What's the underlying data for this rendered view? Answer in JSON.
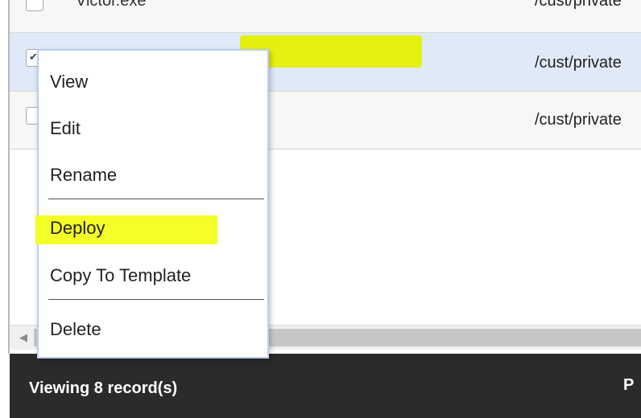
{
  "grid": {
    "rows": [
      {
        "name": "Victor.exe",
        "path": "/cust/private",
        "checked": false,
        "selected": false
      },
      {
        "name": "",
        "path": "/cust/private",
        "checked": true,
        "selected": true
      },
      {
        "name": "",
        "path": "/cust/private",
        "checked": false,
        "selected": false
      }
    ],
    "checkmark_glyph": "✔"
  },
  "context_menu": {
    "items": [
      "View",
      "Edit",
      "Rename",
      "Deploy",
      "Copy To Template",
      "Delete"
    ],
    "highlighted_item": "Deploy"
  },
  "footer": {
    "record_count_text": "Viewing 8 record(s)",
    "right_text": "P"
  },
  "scrollbar": {
    "left_arrow": "◀"
  },
  "colors": {
    "highlight": "#f3ff26",
    "selected_row": "#dfe9f7",
    "footer_bg": "#2b2b2b",
    "menu_border": "#b9cff0"
  }
}
